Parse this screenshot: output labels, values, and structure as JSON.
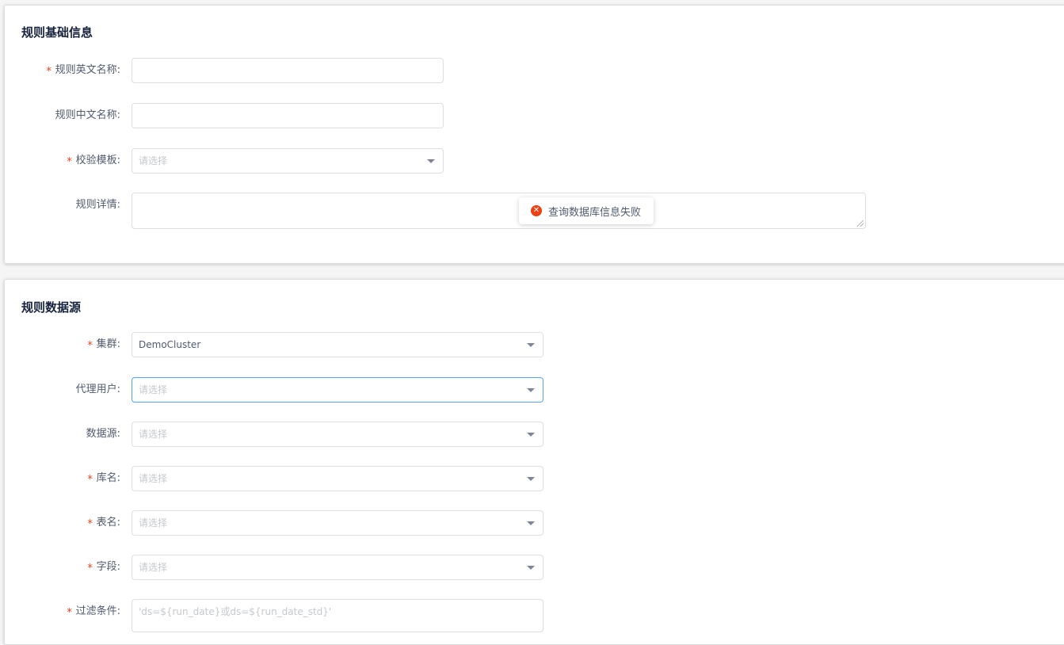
{
  "basic_info": {
    "title": "规则基础信息",
    "fields": {
      "rule_en_name": {
        "label": "规则英文名称:",
        "required": "*",
        "value": ""
      },
      "rule_cn_name": {
        "label": "规则中文名称:",
        "value": ""
      },
      "check_template": {
        "label": "校验模板:",
        "required": "*",
        "placeholder": "请选择"
      },
      "rule_detail": {
        "label": "规则详情:",
        "value": ""
      }
    }
  },
  "data_source": {
    "title": "规则数据源",
    "fields": {
      "cluster": {
        "label": "集群:",
        "required": "*",
        "value": "DemoCluster"
      },
      "proxy_user": {
        "label": "代理用户:",
        "placeholder": "请选择"
      },
      "datasource": {
        "label": "数据源:",
        "placeholder": "请选择"
      },
      "db_name": {
        "label": "库名:",
        "required": "*",
        "placeholder": "请选择"
      },
      "table_name": {
        "label": "表名:",
        "required": "*",
        "placeholder": "请选择"
      },
      "column": {
        "label": "字段:",
        "required": "*",
        "placeholder": "请选择"
      },
      "filter": {
        "label": "过滤条件:",
        "required": "*",
        "placeholder": "'ds=${run_date}或ds=${run_date_std}'"
      }
    }
  },
  "message": {
    "icon": "error-circle-icon",
    "text": "查询数据库信息失败",
    "color": "#ed4014"
  }
}
